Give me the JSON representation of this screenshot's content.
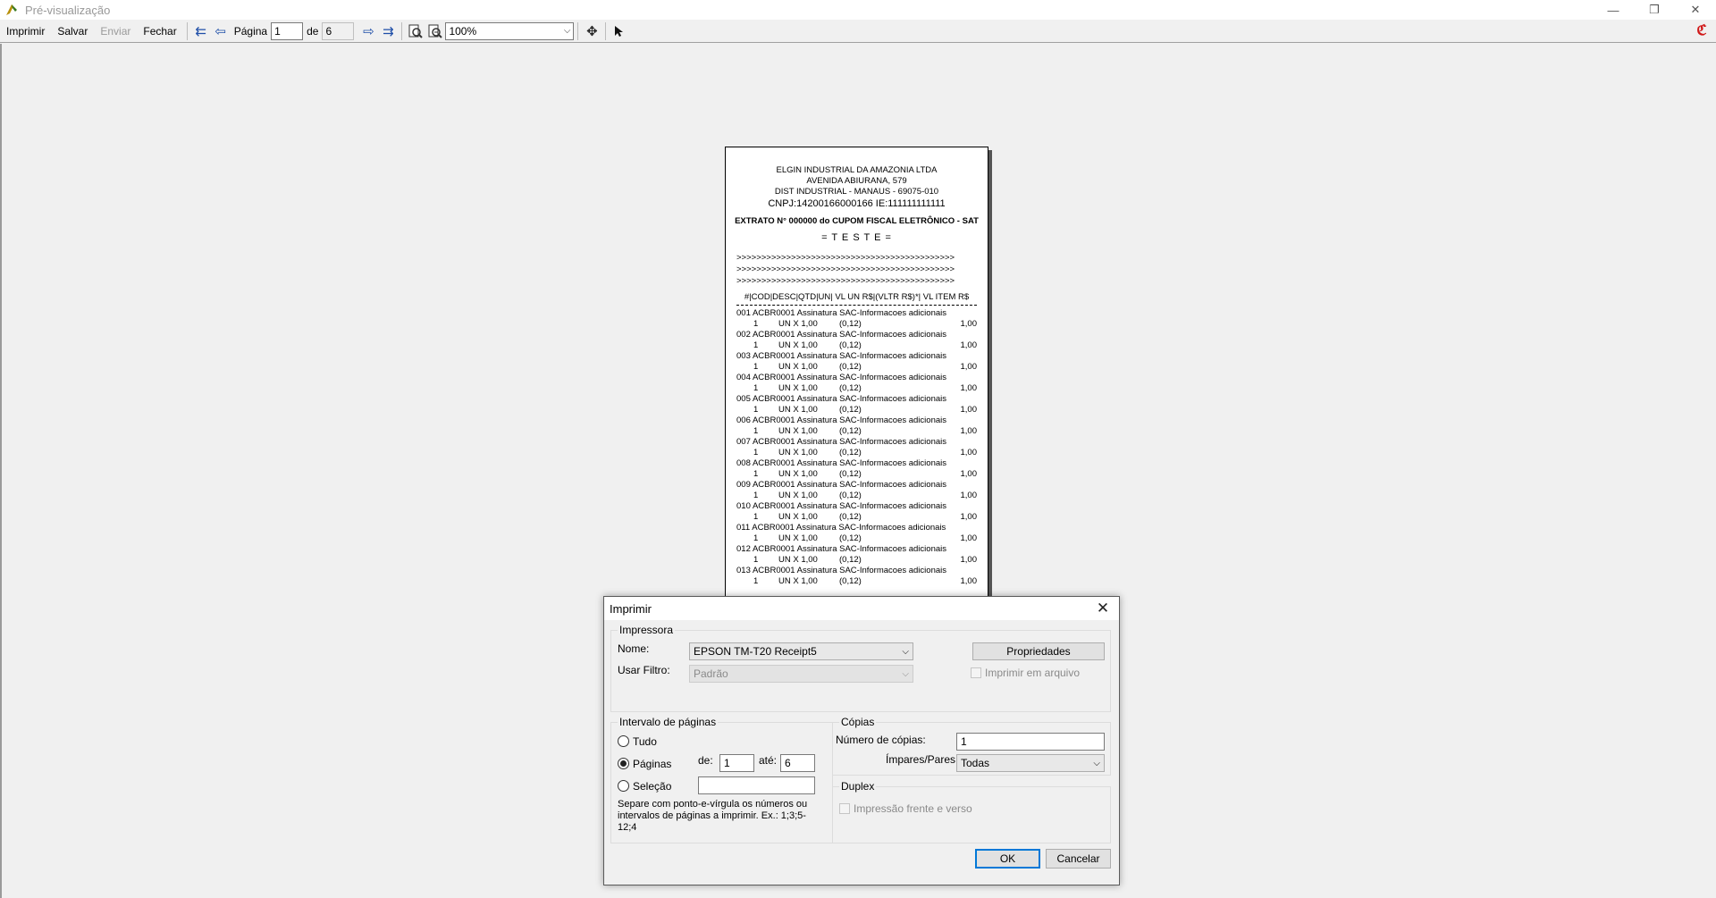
{
  "window": {
    "title": "Pré-visualização",
    "controls": {
      "minimize": "—",
      "restore": "❐",
      "close": "✕"
    }
  },
  "toolbar": {
    "menu": [
      {
        "label": "Imprimir",
        "enabled": true
      },
      {
        "label": "Salvar",
        "enabled": true
      },
      {
        "label": "Enviar",
        "enabled": false
      },
      {
        "label": "Fechar",
        "enabled": true
      }
    ],
    "page_label": "Página",
    "page_current": "1",
    "of_label": "de",
    "page_total": "6",
    "zoom": "100%"
  },
  "receipt": {
    "header": [
      "ELGIN INDUSTRIAL DA AMAZONIA LTDA",
      "AVENIDA ABIURANA, 579",
      "DIST INDUSTRIAL - MANAUS - 69075-010"
    ],
    "cnpj": "CNPJ:14200166000166 IE:111111111111",
    "extrato": "EXTRATO N° 000000 do CUPOM FISCAL ELETRÔNICO - SAT",
    "teste": "= T E S T E =",
    "arrows": [
      ">>>>>>>>>>>>>>>>>>>>>>>>>>>>>>>>>>>>>>>>>>>>",
      ">>>>>>>>>>>>>>>>>>>>>>>>>>>>>>>>>>>>>>>>>>>>",
      ">>>>>>>>>>>>>>>>>>>>>>>>>>>>>>>>>>>>>>>>>>>>"
    ],
    "columns": "#|COD|DESC|QTD|UN| VL UN R$|(VLTR R$)*| VL ITEM R$",
    "items": [
      {
        "line1": "001 ACBR0001 Assinatura SAC-Informacoes adicionais",
        "qty": "1",
        "unit": "UN X 1,00",
        "tax": "(0,12)",
        "value": "1,00"
      },
      {
        "line1": "002 ACBR0001 Assinatura SAC-Informacoes adicionais",
        "qty": "1",
        "unit": "UN X 1,00",
        "tax": "(0,12)",
        "value": "1,00"
      },
      {
        "line1": "003 ACBR0001 Assinatura SAC-Informacoes adicionais",
        "qty": "1",
        "unit": "UN X 1,00",
        "tax": "(0,12)",
        "value": "1,00"
      },
      {
        "line1": "004 ACBR0001 Assinatura SAC-Informacoes adicionais",
        "qty": "1",
        "unit": "UN X 1,00",
        "tax": "(0,12)",
        "value": "1,00"
      },
      {
        "line1": "005 ACBR0001 Assinatura SAC-Informacoes adicionais",
        "qty": "1",
        "unit": "UN X 1,00",
        "tax": "(0,12)",
        "value": "1,00"
      },
      {
        "line1": "006 ACBR0001 Assinatura SAC-Informacoes adicionais",
        "qty": "1",
        "unit": "UN X 1,00",
        "tax": "(0,12)",
        "value": "1,00"
      },
      {
        "line1": "007 ACBR0001 Assinatura SAC-Informacoes adicionais",
        "qty": "1",
        "unit": "UN X 1,00",
        "tax": "(0,12)",
        "value": "1,00"
      },
      {
        "line1": "008 ACBR0001 Assinatura SAC-Informacoes adicionais",
        "qty": "1",
        "unit": "UN X 1,00",
        "tax": "(0,12)",
        "value": "1,00"
      },
      {
        "line1": "009 ACBR0001 Assinatura SAC-Informacoes adicionais",
        "qty": "1",
        "unit": "UN X 1,00",
        "tax": "(0,12)",
        "value": "1,00"
      },
      {
        "line1": "010 ACBR0001 Assinatura SAC-Informacoes adicionais",
        "qty": "1",
        "unit": "UN X 1,00",
        "tax": "(0,12)",
        "value": "1,00"
      },
      {
        "line1": "011 ACBR0001 Assinatura SAC-Informacoes adicionais",
        "qty": "1",
        "unit": "UN X 1,00",
        "tax": "(0,12)",
        "value": "1,00"
      },
      {
        "line1": "012 ACBR0001 Assinatura SAC-Informacoes adicionais",
        "qty": "1",
        "unit": "UN X 1,00",
        "tax": "(0,12)",
        "value": "1,00"
      },
      {
        "line1": "013 ACBR0001 Assinatura SAC-Informacoes adicionais",
        "qty": "1",
        "unit": "UN X 1,00",
        "tax": "(0,12)",
        "value": "1,00"
      }
    ]
  },
  "print_dialog": {
    "title": "Imprimir",
    "printer_group": "Impressora",
    "name_label": "Nome:",
    "printer_name": "EPSON TM-T20 Receipt5",
    "properties_button": "Propriedades",
    "filter_label": "Usar Filtro:",
    "filter_value": "Padrão",
    "print_to_file": "Imprimir em arquivo",
    "range_group": "Intervalo de páginas",
    "range_all": "Tudo",
    "range_pages": "Páginas",
    "range_selection": "Seleção",
    "from_label": "de:",
    "from_value": "1",
    "to_label": "até:",
    "to_value": "6",
    "selection_value": "",
    "range_note": "Separe com ponto-e-vírgula os números ou intervalos de páginas a imprimir. Ex.: 1;3;5-12;4",
    "copies_group": "Cópias",
    "copies_label": "Número de cópias:",
    "copies_value": "1",
    "odd_even_label": "Ímpares/Pares:",
    "odd_even_value": "Todas",
    "duplex_group": "Duplex",
    "duplex_option": "Impressão frente e verso",
    "ok_button": "OK",
    "cancel_button": "Cancelar"
  }
}
